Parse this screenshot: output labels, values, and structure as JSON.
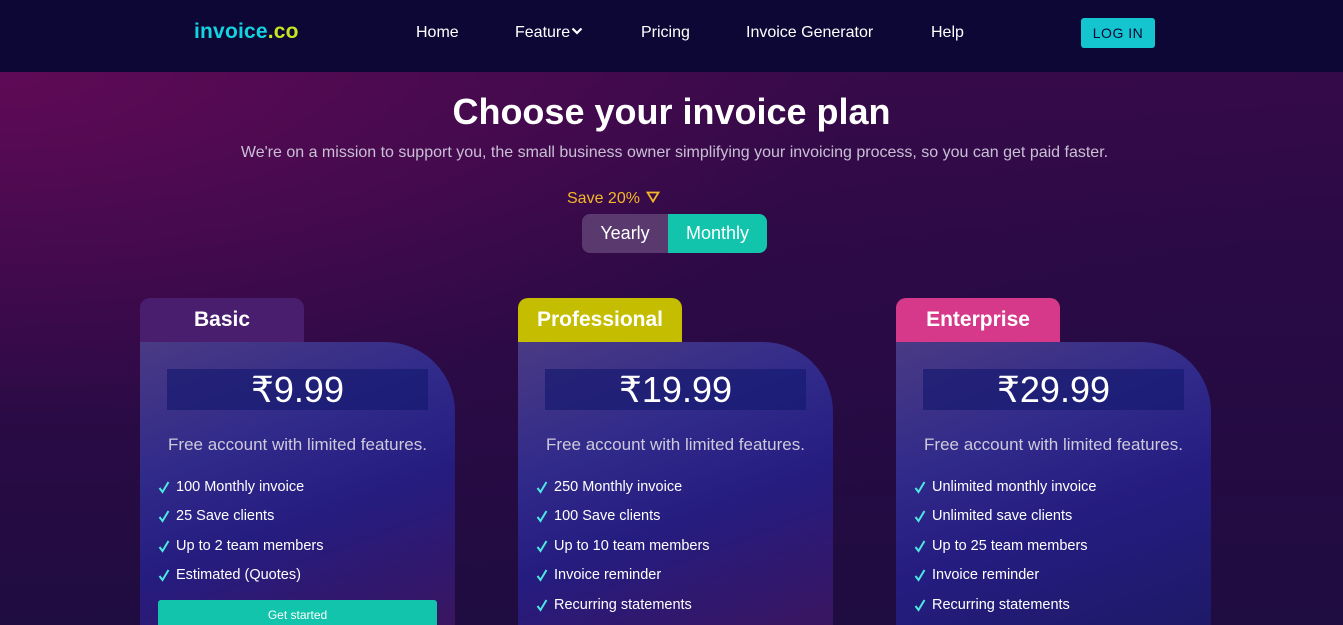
{
  "nav": {
    "logo_part1": "invoice",
    "logo_part2": ".co",
    "links": [
      "Home",
      "Feature",
      "Pricing",
      "Invoice Generator",
      "Help"
    ],
    "login_label": "LOG IN"
  },
  "hero": {
    "title": "Choose your invoice plan",
    "subtitle": "We're on a mission to support you, the small business owner simplifying your invoicing process, so you can get paid faster.",
    "save_label": "Save 20%",
    "toggle": {
      "yearly": "Yearly",
      "monthly": "Monthly",
      "selected": "Monthly"
    }
  },
  "plans": [
    {
      "name": "Basic",
      "price": "₹9.99",
      "description": "Free account with limited features.",
      "features": [
        "100 Monthly invoice",
        "25 Save clients",
        "Up to 2 team members",
        "Estimated (Quotes)"
      ],
      "cta": "Get started"
    },
    {
      "name": "Professional",
      "price": "₹19.99",
      "description": "Free account with limited features.",
      "features": [
        "250 Monthly invoice",
        "100 Save clients",
        "Up to 10 team members",
        "Invoice reminder",
        "Recurring statements"
      ]
    },
    {
      "name": "Enterprise",
      "price": "₹29.99",
      "description": "Free account with limited features.",
      "features": [
        "Unlimited monthly invoice",
        "Unlimited save clients",
        "Up to 25 team members",
        "Invoice reminder",
        "Recurring statements"
      ]
    }
  ],
  "colors": {
    "nav_bg": "#0d0735",
    "accent_teal": "#13c4ad",
    "logo_cyan": "#14d3e0",
    "logo_lime": "#c8e620",
    "save_orange": "#f4b728",
    "tab_basic": "#4a1e6e",
    "tab_professional": "#c4bd00",
    "tab_enterprise": "#d6388a"
  }
}
